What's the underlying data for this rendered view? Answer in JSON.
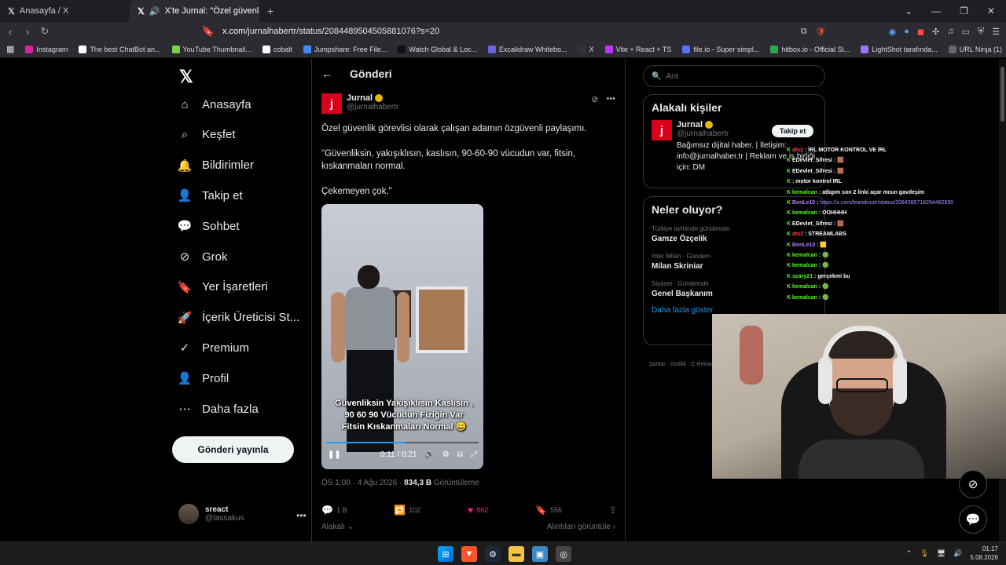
{
  "browser": {
    "tabs": [
      {
        "label": "Anasayfa / X"
      },
      {
        "label": "X'te Jurnal: \"Özel güvenlik gö"
      }
    ],
    "new_tab": "+",
    "url_host": "x.com",
    "url_path": "/jurnalhabertr/status/2084489504505881076?s=20",
    "bookmarks": [
      {
        "label": "Instagram",
        "color": "#d6249f"
      },
      {
        "label": "The best ChatBot an...",
        "color": "#ffffff"
      },
      {
        "label": "YouTube Thumbnail...",
        "color": "#7bd148"
      },
      {
        "label": "cobalt",
        "color": "#ffffff"
      },
      {
        "label": "Jumpshare: Free File...",
        "color": "#3f8cff"
      },
      {
        "label": "Watch Global & Loc...",
        "color": "#111111"
      },
      {
        "label": "Excalidraw Whitebo...",
        "color": "#6965db"
      },
      {
        "label": "X",
        "color": "#333333"
      },
      {
        "label": "Vite + React + TS",
        "color": "#bd34fe"
      },
      {
        "label": "file.io - Super simpl...",
        "color": "#5b6cff"
      },
      {
        "label": "hitbox.io - Official Si...",
        "color": "#2aa84a"
      },
      {
        "label": "LightShot tarafında...",
        "color": "#a070ff"
      },
      {
        "label": "URL Ninja (1)",
        "color": "#666666"
      }
    ]
  },
  "nav": {
    "items": [
      {
        "label": "Anasayfa",
        "icon": "home-icon"
      },
      {
        "label": "Keşfet",
        "icon": "search-icon"
      },
      {
        "label": "Bildirimler",
        "icon": "bell-icon"
      },
      {
        "label": "Takip et",
        "icon": "add-user-icon"
      },
      {
        "label": "Sohbet",
        "icon": "chat-icon"
      },
      {
        "label": "Grok",
        "icon": "grok-icon"
      },
      {
        "label": "Yer İşaretleri",
        "icon": "bookmark-icon"
      },
      {
        "label": "İçerik Üreticisi St...",
        "icon": "rocket-icon"
      },
      {
        "label": "Premium",
        "icon": "verified-icon"
      },
      {
        "label": "Profil",
        "icon": "profile-icon"
      },
      {
        "label": "Daha fazla",
        "icon": "more-icon"
      }
    ],
    "post_button": "Gönderi yayınla",
    "user": {
      "name": "sreact",
      "handle": "@tassakus"
    }
  },
  "post": {
    "header": "Gönderi",
    "author_name": "Jurnal",
    "author_handle": "@jurnalhabertr",
    "avatar_letter": "j",
    "text": [
      "Özel güvenlik görevlisi olarak çalışan adamın özgüvenli paylaşımı.",
      "\"Güvenliksin, yakışıklısın, kaslısın, 90-60-90 vücudun var, fitsin, kıskanmaları normal.",
      "Çekemeyen çok.\""
    ],
    "video": {
      "caption": "Güvenliksin Yakışıklısın Kaslısın , 90 60 90 Vücudun Fiziğin Var Fitsin Kıskanmaları Normal 😄",
      "time": "0:11 / 0:21",
      "progress": 0.52
    },
    "meta_time": "ÖS 1:00 · 4 Ağu 2026 · ",
    "views": "834,3 B",
    "views_label": " Görüntüleme",
    "replies": "1 B",
    "reposts": "102",
    "likes": "862",
    "bookmarks": "556",
    "related": "Alakalı",
    "quotes": "Alıntıları görüntüle"
  },
  "sidebar": {
    "search_placeholder": "Ara",
    "related_title": "Alakalı kişiler",
    "related_user": {
      "name": "Jurnal",
      "handle": "@jurnalhabertr",
      "bio": "Bağımsız dijital haber. | İletişim: info@jurnalhaber.tr | Reklam ve iş birliği için: DM",
      "follow": "Takip et"
    },
    "trends_title": "Neler oluyor?",
    "trends": [
      {
        "category": "Türkiye tarihinde gündemde",
        "name": "Gamze Özçelik"
      },
      {
        "category": "Inter Milan · Gündem",
        "name": "Milan Skriniar"
      },
      {
        "category": "Siyaset · Gündemde",
        "name": "Genel Başkanım"
      }
    ],
    "show_more": "Daha fazla göster",
    "footer": "Şartlar · Gizlilik · Ç Reklam Bilgileri · Da"
  },
  "chat": [
    {
      "user": "ats2",
      "ucolor": "red",
      "text": "İRL MOTOR KONTROL VE İRL"
    },
    {
      "user": "EDevlet_Sifresi",
      "ucolor": "white",
      "text": "🟫"
    },
    {
      "user": "EDevlet_Sifresi",
      "ucolor": "white",
      "text": "🟫"
    },
    {
      "user": "",
      "ucolor": "green",
      "text": "motor kontrol IRL"
    },
    {
      "user": "kemalcan",
      "ucolor": "green",
      "text": "atbgım son 2 linki açar mısın gavdeşim"
    },
    {
      "user": "BenLe10",
      "ucolor": "purple",
      "text": "https://x.com/leandroutr/status/2084385718294482990",
      "link": true
    },
    {
      "user": "kemalcan",
      "ucolor": "green",
      "text": "OOHHHH"
    },
    {
      "user": "EDevlet_Sifresi",
      "ucolor": "white",
      "text": "🟫"
    },
    {
      "user": "ats2",
      "ucolor": "red",
      "text": "STREAMLABS"
    },
    {
      "user": "BenLe10",
      "ucolor": "purple",
      "text": "🟨"
    },
    {
      "user": "kemalcan",
      "ucolor": "green",
      "text": "🟢"
    },
    {
      "user": "kemalcan",
      "ucolor": "green",
      "text": "🟢"
    },
    {
      "user": "scary21",
      "ucolor": "green",
      "text": "gerçekmi bu"
    },
    {
      "user": "kemalcan",
      "ucolor": "green",
      "text": "🟢"
    },
    {
      "user": "kemalcan",
      "ucolor": "green",
      "text": "🟢"
    }
  ],
  "taskbar": {
    "time": "01:17",
    "date": "5.08.2026"
  }
}
